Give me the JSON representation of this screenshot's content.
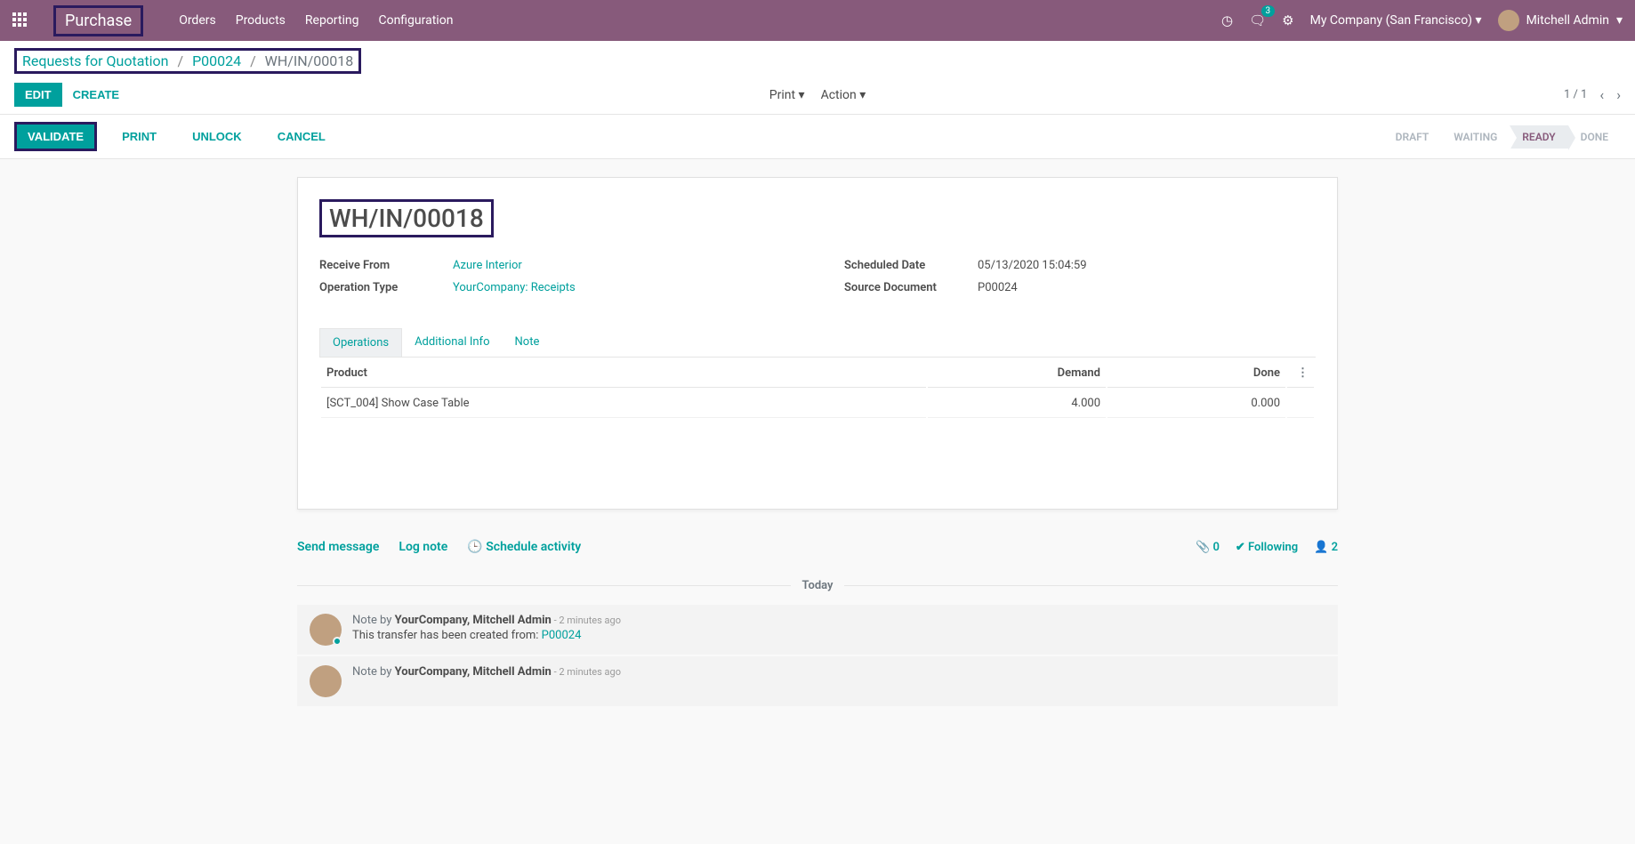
{
  "navbar": {
    "brand": "Purchase",
    "menu": [
      "Orders",
      "Products",
      "Reporting",
      "Configuration"
    ],
    "msg_count": "3",
    "company": "My Company (San Francisco)",
    "user": "Mitchell Admin"
  },
  "breadcrumb": {
    "root": "Requests for Quotation",
    "parent": "P00024",
    "current": "WH/IN/00018"
  },
  "cp": {
    "edit": "EDIT",
    "create": "CREATE",
    "print": "Print",
    "action": "Action",
    "pager": "1 / 1"
  },
  "statusbar": {
    "validate": "VALIDATE",
    "print": "PRINT",
    "unlock": "UNLOCK",
    "cancel": "CANCEL",
    "steps": [
      "DRAFT",
      "WAITING",
      "READY",
      "DONE"
    ],
    "active_step": "READY"
  },
  "form": {
    "title": "WH/IN/00018",
    "fields": {
      "receive_from_label": "Receive From",
      "receive_from_value": "Azure Interior",
      "operation_type_label": "Operation Type",
      "operation_type_value": "YourCompany: Receipts",
      "scheduled_date_label": "Scheduled Date",
      "scheduled_date_value": "05/13/2020 15:04:59",
      "source_document_label": "Source Document",
      "source_document_value": "P00024"
    },
    "tabs": [
      "Operations",
      "Additional Info",
      "Note"
    ],
    "table": {
      "headers": {
        "product": "Product",
        "demand": "Demand",
        "done": "Done"
      },
      "rows": [
        {
          "product": "[SCT_004] Show Case Table",
          "demand": "4.000",
          "done": "0.000"
        }
      ]
    }
  },
  "chatter": {
    "send_message": "Send message",
    "log_note": "Log note",
    "schedule": "Schedule activity",
    "attachments": "0",
    "following": "Following",
    "followers": "2",
    "divider": "Today",
    "messages": [
      {
        "prefix": "Note by ",
        "author": "YourCompany, Mitchell Admin",
        "time": " - 2 minutes ago",
        "content_pre": "This transfer has been created from: ",
        "content_link": "P00024"
      },
      {
        "prefix": "Note by ",
        "author": "YourCompany, Mitchell Admin",
        "time": " - 2 minutes ago",
        "content_pre": "",
        "content_link": ""
      }
    ]
  }
}
